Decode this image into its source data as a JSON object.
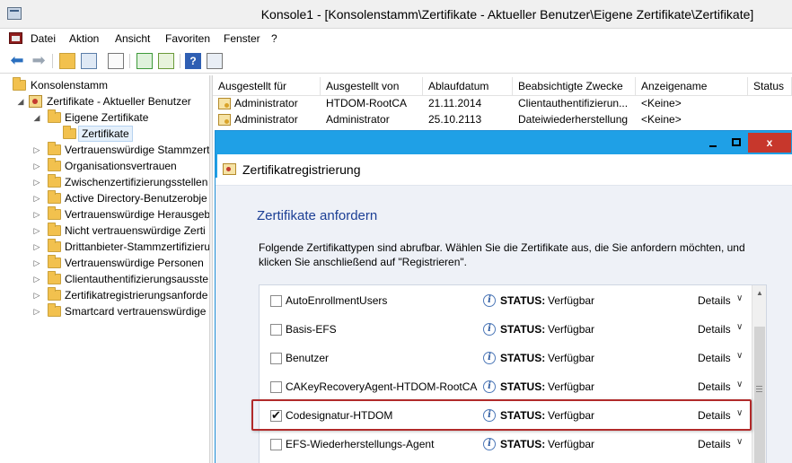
{
  "window": {
    "title": "Konsole1 - [Konsolenstamm\\Zertifikate - Aktueller Benutzer\\Eigene Zertifikate\\Zertifikate]"
  },
  "menu": [
    "Datei",
    "Aktion",
    "Ansicht",
    "Favoriten",
    "Fenster",
    "?"
  ],
  "toolbar": {
    "icons": [
      "back-arrow-icon",
      "forward-arrow-icon",
      "up-folder-icon",
      "show-hide-tree-icon",
      "clipboard-icon",
      "refresh-icon",
      "export-list-icon",
      "help-icon",
      "action-pane-icon"
    ],
    "help_label": "?"
  },
  "tree": {
    "root": "Konsolenstamm",
    "store": "Zertifikate - Aktueller Benutzer",
    "personal": "Eigene Zertifikate",
    "selected": "Zertifikate",
    "folders": [
      "Vertrauenswürdige Stammzert",
      "Organisationsvertrauen",
      "Zwischenzertifizierungsstellen",
      "Active Directory-Benutzerobje",
      "Vertrauenswürdige Herausgeb",
      "Nicht vertrauenswürdige Zerti",
      "Drittanbieter-Stammzertifizieru",
      "Vertrauenswürdige Personen",
      "Clientauthentifizierungsausste",
      "Zertifikatregistrierungsanforde",
      "Smartcard vertrauenswürdige"
    ]
  },
  "listview": {
    "columns": [
      "Ausgestellt für",
      "Ausgestellt von",
      "Ablaufdatum",
      "Beabsichtigte Zwecke",
      "Anzeigename",
      "Status"
    ],
    "rows": [
      [
        "Administrator",
        "HTDOM-RootCA",
        "21.11.2014",
        "Clientauthentifizierun...",
        "<Keine>",
        ""
      ],
      [
        "Administrator",
        "Administrator",
        "25.10.2113",
        "Dateiwiederherstellung",
        "<Keine>",
        ""
      ]
    ]
  },
  "dialog": {
    "title": "Zertifikatregistrierung",
    "heading": "Zertifikate anfordern",
    "intro": "Folgende Zertifikattypen sind abrufbar. Wählen Sie die Zertifikate aus, die Sie anfordern möchten, und klicken Sie anschließend auf \"Registrieren\".",
    "caption": {
      "minimize": "",
      "maximize": "",
      "close": "x"
    },
    "status_label": "STATUS:",
    "details_label": "Details",
    "info_glyph": "i",
    "chevron": "∨",
    "certs": [
      {
        "name": "AutoEnrollmentUsers",
        "status": "Verfügbar",
        "checked": false
      },
      {
        "name": "Basis-EFS",
        "status": "Verfügbar",
        "checked": false
      },
      {
        "name": "Benutzer",
        "status": "Verfügbar",
        "checked": false
      },
      {
        "name": "CAKeyRecoveryAgent-HTDOM-RootCA",
        "status": "Verfügbar",
        "checked": false
      },
      {
        "name": "Codesignatur-HTDOM",
        "status": "Verfügbar",
        "checked": true
      },
      {
        "name": "EFS-Wiederherstellungs-Agent",
        "status": "Verfügbar",
        "checked": false
      }
    ]
  },
  "colors": {
    "accent_blue": "#1fa0e6",
    "heading_blue": "#1c3f95",
    "close_red": "#c7372c",
    "highlight_red": "#b12a2a"
  }
}
